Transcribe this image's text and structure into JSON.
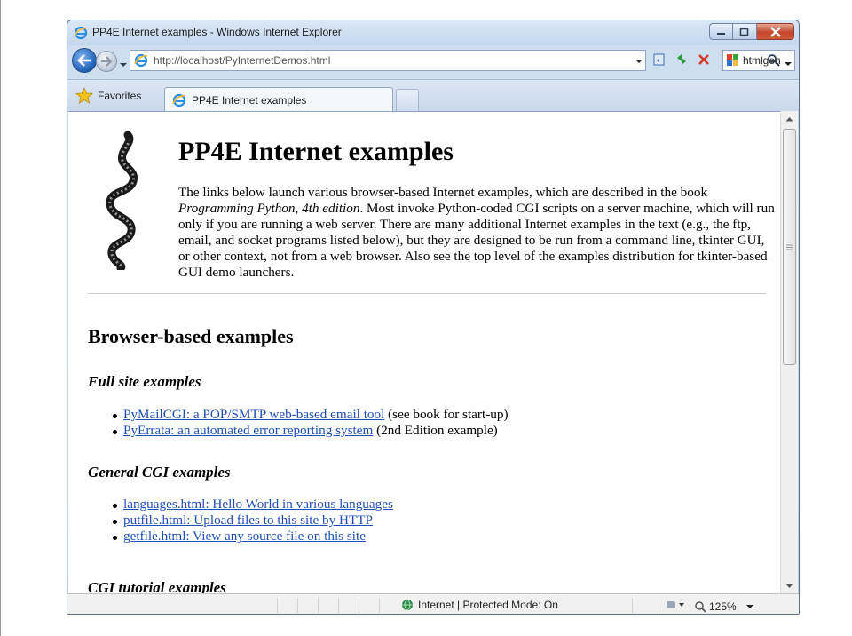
{
  "window": {
    "title": "PP4E Internet examples - Windows Internet Explorer"
  },
  "navbar": {
    "url": "http://localhost/PyInternetDemos.html",
    "search_provider": "htmlgen"
  },
  "tabbar": {
    "favorites_label": "Favorites",
    "active_tab_label": "PP4E Internet examples"
  },
  "content": {
    "heading": "PP4E Internet examples",
    "intro_part1": "The links below launch various browser-based Internet examples, which are described in the book ",
    "intro_book": "Programming Python, 4th edition",
    "intro_part2": ". Most invoke Python-coded CGI scripts on a server machine, which will run only if you are running a web server. There are many additional Internet examples in the text (e.g., the ftp, email, and socket programs listed below), but they are designed to be run from a command line, tkinter GUI, or other context, not from a web browser. Also see the top level of the examples distribution for tkinter-based GUI demo launchers.",
    "section_heading": "Browser-based examples",
    "full_site": {
      "heading": "Full site examples",
      "items": [
        {
          "link": "PyMailCGI: a POP/SMTP web-based email tool",
          "note": " (see book for start-up)"
        },
        {
          "link": "PyErrata: an automated error reporting system",
          "note": " (2nd Edition example)"
        }
      ]
    },
    "general_cgi": {
      "heading": "General CGI examples",
      "items": [
        {
          "link": "languages.html: Hello World in various languages"
        },
        {
          "link": "putfile.html: Upload files to this site by HTTP"
        },
        {
          "link": "getfile.html: View any source file on this site"
        }
      ]
    },
    "cgi_tutorial": {
      "heading": "CGI tutorial examples"
    }
  },
  "statusbar": {
    "zone": "Internet | Protected Mode: On",
    "zoom": "125%"
  },
  "colors": {
    "link": "#1e4fb4",
    "close_button": "#c5452a",
    "window_frame": "#bcd1e8"
  }
}
